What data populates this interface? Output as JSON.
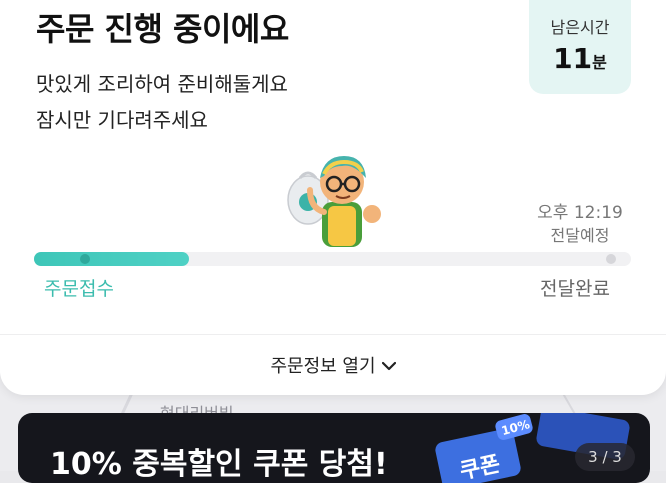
{
  "order_status": {
    "title": "주문 진행 중이에요",
    "message_line1": "맛있게 조리하여 준비해둘게요",
    "message_line2": "잠시만 기다려주세요"
  },
  "remaining_time": {
    "label": "남은시간",
    "value": "11",
    "unit": "분"
  },
  "delivery_eta": {
    "time": "오후 12:19",
    "label": "전달예정"
  },
  "progress": {
    "fraction": 0.26,
    "start_label": "주문접수",
    "end_label": "전달완료"
  },
  "order_info_toggle": {
    "label": "주문정보 열기"
  },
  "map": {
    "visible_label": "현대리버빌"
  },
  "promo_banner": {
    "text": "10% 중복할인 쿠폰 당첨!",
    "coupon_word": "쿠폰",
    "coupon_tag": "10%",
    "page_indicator": "3 / 3"
  },
  "colors": {
    "accent": "#3ec6b8",
    "time_box_bg": "#e4f5f3",
    "banner_bg": "#15161c"
  }
}
